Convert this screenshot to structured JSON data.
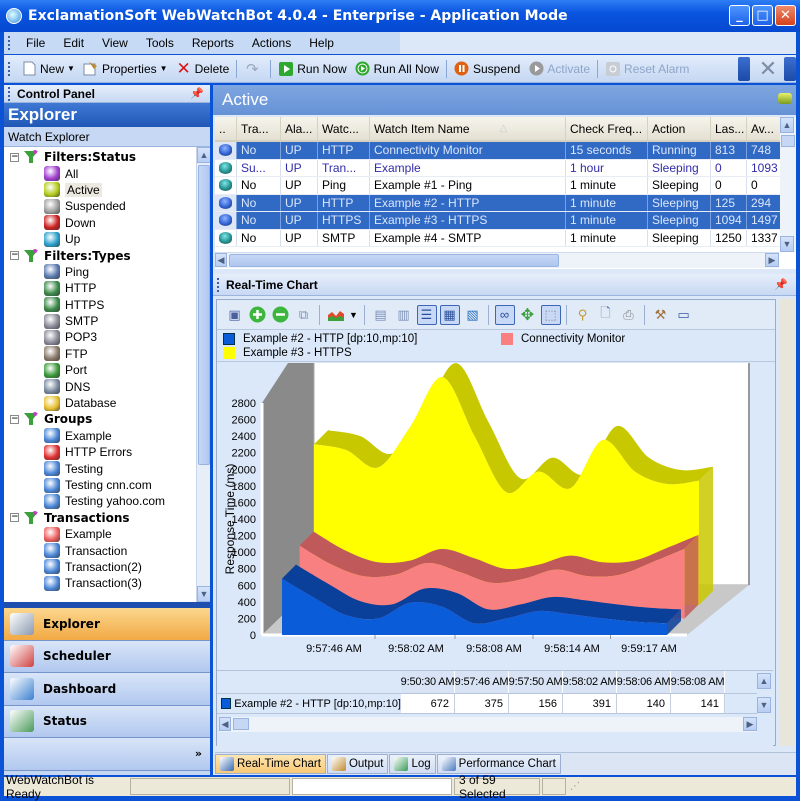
{
  "window": {
    "title": "ExclamationSoft WebWatchBot 4.0.4 - Enterprise - Application Mode",
    "controls": {
      "minimize": "_",
      "maximize": "□",
      "close": "✕"
    }
  },
  "menubar": {
    "items": [
      "File",
      "Edit",
      "View",
      "Tools",
      "Reports",
      "Actions",
      "Help"
    ]
  },
  "toolbar": {
    "new": "New",
    "properties": "Properties",
    "delete": "Delete",
    "run_now": "Run Now",
    "run_all_now": "Run All Now",
    "suspend": "Suspend",
    "activate": "Activate",
    "reset_alarm": "Reset Alarm"
  },
  "control_panel": {
    "title": "Control Panel",
    "explorer_title": "Explorer",
    "watch_explorer": "Watch Explorer",
    "tree": [
      {
        "label": "Filters:Status",
        "icon": "filter-icon",
        "children": [
          {
            "label": "All",
            "icon": "status-all-icon",
            "color": "#a23fd0"
          },
          {
            "label": "Active",
            "icon": "status-active-icon",
            "color": "#b4cc1a",
            "selected": true
          },
          {
            "label": "Suspended",
            "icon": "status-suspended-icon",
            "color": "#a0a0a0"
          },
          {
            "label": "Down",
            "icon": "status-down-icon",
            "color": "#cc2020"
          },
          {
            "label": "Up",
            "icon": "status-up-icon",
            "color": "#2aa0cc"
          }
        ]
      },
      {
        "label": "Filters:Types",
        "icon": "filter-icon",
        "children": [
          {
            "label": "Ping",
            "icon": "ping-icon",
            "color": "#5a7ab0"
          },
          {
            "label": "HTTP",
            "icon": "http-globe-icon",
            "color": "#3b8a4a"
          },
          {
            "label": "HTTPS",
            "icon": "https-globe-lock-icon",
            "color": "#3b8a4a"
          },
          {
            "label": "SMTP",
            "icon": "smtp-server-icon",
            "color": "#8a8a9a"
          },
          {
            "label": "POP3",
            "icon": "pop3-server-icon",
            "color": "#8a8a9a"
          },
          {
            "label": "FTP",
            "icon": "ftp-server-icon",
            "color": "#8a7a6a"
          },
          {
            "label": "Port",
            "icon": "port-icon",
            "color": "#3a9a3a"
          },
          {
            "label": "DNS",
            "icon": "dns-magnifier-icon",
            "color": "#7a8aa0"
          },
          {
            "label": "Database",
            "icon": "database-icon",
            "color": "#e8c030"
          }
        ]
      },
      {
        "label": "Groups",
        "icon": "filter-icon",
        "children": [
          {
            "label": "Example",
            "icon": "group-icon",
            "color": "#4a86d8"
          },
          {
            "label": "HTTP Errors",
            "icon": "group-error-icon",
            "color": "#e03030"
          },
          {
            "label": "Testing",
            "icon": "group-icon",
            "color": "#4a86d8"
          },
          {
            "label": "Testing cnn.com",
            "icon": "group-icon",
            "color": "#4a86d8"
          },
          {
            "label": "Testing yahoo.com",
            "icon": "group-icon",
            "color": "#4a86d8"
          }
        ]
      },
      {
        "label": "Transactions",
        "icon": "filter-icon",
        "children": [
          {
            "label": "Example",
            "icon": "transaction-error-icon",
            "color": "#f06060"
          },
          {
            "label": "Transaction",
            "icon": "transaction-icon",
            "color": "#4a86d8"
          },
          {
            "label": "Transaction(2)",
            "icon": "transaction-icon",
            "color": "#4a86d8"
          },
          {
            "label": "Transaction(3)",
            "icon": "transaction-icon",
            "color": "#4a86d8"
          }
        ]
      }
    ],
    "nav_buttons": [
      {
        "label": "Explorer",
        "icon": "explorer-icon",
        "active": true
      },
      {
        "label": "Scheduler",
        "icon": "scheduler-icon",
        "active": false
      },
      {
        "label": "Dashboard",
        "icon": "dashboard-monitor-icon",
        "active": false
      },
      {
        "label": "Status",
        "icon": "status-graph-icon",
        "active": false
      }
    ],
    "more": "»"
  },
  "active_panel": {
    "title": "Active",
    "columns": [
      "..",
      "Tra...",
      "Ala...",
      "Watc...",
      "Watch Item Name",
      "Check Freq...",
      "Action",
      "Las...",
      "Av..."
    ],
    "rows": [
      {
        "selected": true,
        "purple": false,
        "cells": [
          "",
          "No",
          "UP",
          "HTTP",
          "Connectivity Monitor",
          "15 seconds",
          "Running",
          "813",
          "748"
        ]
      },
      {
        "selected": false,
        "purple": true,
        "cells": [
          "",
          "Su...",
          "UP",
          "Tran...",
          "Example",
          "1 hour",
          "Sleeping",
          "0",
          "1093"
        ]
      },
      {
        "selected": false,
        "purple": false,
        "cells": [
          "",
          "No",
          "UP",
          "Ping",
          "Example #1 - Ping",
          "1 minute",
          "Sleeping",
          "0",
          "0"
        ]
      },
      {
        "selected": true,
        "purple": false,
        "cells": [
          "",
          "No",
          "UP",
          "HTTP",
          "Example #2 - HTTP",
          "1 minute",
          "Sleeping",
          "125",
          "294"
        ]
      },
      {
        "selected": true,
        "purple": false,
        "cells": [
          "",
          "No",
          "UP",
          "HTTPS",
          "Example #3 - HTTPS",
          "1 minute",
          "Sleeping",
          "1094",
          "1497"
        ]
      },
      {
        "selected": false,
        "purple": false,
        "cells": [
          "",
          "No",
          "UP",
          "SMTP",
          "Example #4 - SMTP",
          "1 minute",
          "Sleeping",
          "1250",
          "1337"
        ]
      }
    ]
  },
  "realtime_chart": {
    "title": "Real-Time Chart",
    "legend": [
      {
        "label": "Example #2 - HTTP [dp:10,mp:10]",
        "color": "#0a5cd8"
      },
      {
        "label": "Example #3 - HTTPS",
        "color": "#ffff00"
      },
      {
        "label": "Connectivity Monitor",
        "color": "#f88080"
      }
    ],
    "table": {
      "headers": [
        "9:50:30 AM",
        "9:57:46 AM",
        "9:57:50 AM",
        "9:58:02 AM",
        "9:58:06 AM",
        "9:58:08 AM"
      ],
      "row_label": "Example #2 - HTTP [dp:10,mp:10]",
      "values": [
        "672",
        "375",
        "156",
        "391",
        "140",
        "141"
      ]
    }
  },
  "chart_data": {
    "type": "area",
    "title": "",
    "xlabel": "",
    "ylabel": "Response Time (ms)",
    "ylim": [
      0,
      2800
    ],
    "yticks": [
      0,
      200,
      400,
      600,
      800,
      1000,
      1200,
      1400,
      1600,
      1800,
      2000,
      2200,
      2400,
      2600,
      2800
    ],
    "xtick_labels": [
      "9:57:46 AM",
      "9:58:02 AM",
      "9:58:08 AM",
      "9:58:14 AM",
      "9:59:17 AM"
    ],
    "stacked": true,
    "grid": false,
    "legend_position": "top",
    "series": [
      {
        "name": "Example #2 - HTTP [dp:10,mp:10]",
        "color": "#0a5cd8",
        "values": [
          680,
          450,
          240,
          200,
          390,
          340,
          140,
          200,
          290,
          250,
          200,
          160,
          140
        ]
      },
      {
        "name": "Connectivity Monitor",
        "color": "#f88080",
        "values": [
          200,
          200,
          270,
          330,
          280,
          220,
          290,
          280,
          300,
          260,
          330,
          520,
          700
        ]
      },
      {
        "name": "Example #3 - HTTPS",
        "color": "#ffff00",
        "values": [
          1060,
          1220,
          1150,
          1620,
          2080,
          1480,
          930,
          1130,
          820,
          1480,
          1080,
          780,
          660
        ]
      }
    ]
  },
  "bottom_tabs": [
    {
      "label": "Real-Time Chart",
      "icon": "realtime-chart-icon",
      "active": true
    },
    {
      "label": "Output",
      "icon": "output-pencil-icon",
      "active": false
    },
    {
      "label": "Log",
      "icon": "log-book-icon",
      "active": false
    },
    {
      "label": "Performance Chart",
      "icon": "performance-chart-icon",
      "active": false
    }
  ],
  "statusbar": {
    "text": "WebWatchBot is Ready",
    "selection": "3 of 59 Selected"
  }
}
